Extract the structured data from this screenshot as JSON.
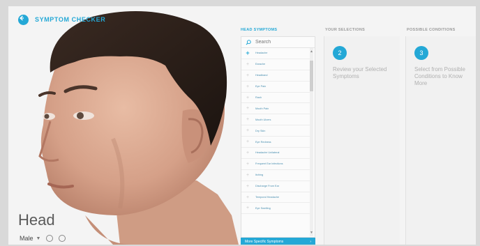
{
  "header": {
    "title": "SYMPTOM CHECKER"
  },
  "viewer": {
    "body_part": "Head",
    "gender": {
      "selected": "Male"
    }
  },
  "columns": {
    "head_symptoms": "HEAD SYMPTOMS",
    "your_selections": "YOUR SELECTIONS",
    "possible_conditions": "POSSIBLE CONDITIONS"
  },
  "search": {
    "placeholder": "Search"
  },
  "symptoms": [
    "Headache",
    "Earache",
    "Headband",
    "Eye Pain",
    "Rash",
    "Mouth Pain",
    "Mouth Ulcers",
    "Dry Skin",
    "Eye Redness",
    "Headache Unilateral",
    "Frequent Ear Infections",
    "Itching",
    "Discharge From Ear",
    "Temporal Headache",
    "Eye Swelling"
  ],
  "more_button": "More Specific Symptoms",
  "steps": {
    "selections": {
      "number": "2",
      "text": "Review your Selected Symptoms"
    },
    "conditions": {
      "number": "3",
      "text": "Select from Possible Conditions to Know More"
    }
  },
  "colors": {
    "accent": "#24a8d6"
  }
}
